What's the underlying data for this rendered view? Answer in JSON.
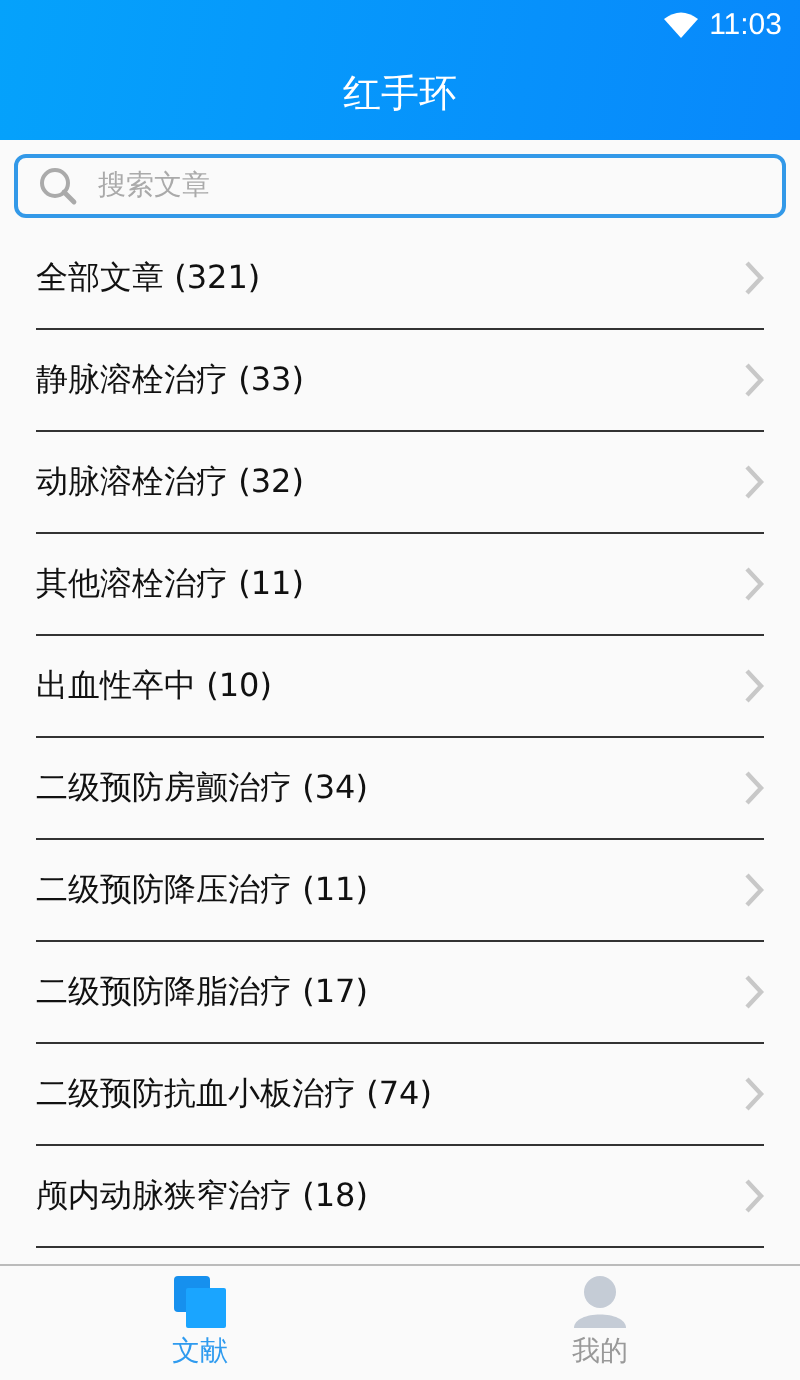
{
  "status_bar": {
    "time": "11:03"
  },
  "title": "红手环",
  "search": {
    "placeholder": "搜索文章"
  },
  "categories": [
    {
      "label": "全部文章 (321)"
    },
    {
      "label": "静脉溶栓治疗 (33)"
    },
    {
      "label": "动脉溶栓治疗 (32)"
    },
    {
      "label": "其他溶栓治疗 (11)"
    },
    {
      "label": "出血性卒中 (10)"
    },
    {
      "label": "二级预防房颤治疗 (34)"
    },
    {
      "label": "二级预防降压治疗 (11)"
    },
    {
      "label": "二级预防降脂治疗 (17)"
    },
    {
      "label": "二级预防抗血小板治疗 (74)"
    },
    {
      "label": "颅内动脉狭窄治疗 (18)"
    }
  ],
  "tabs": [
    {
      "label": "文献",
      "kind": "docs",
      "selected": true
    },
    {
      "label": "我的",
      "kind": "profile",
      "selected": false
    }
  ]
}
